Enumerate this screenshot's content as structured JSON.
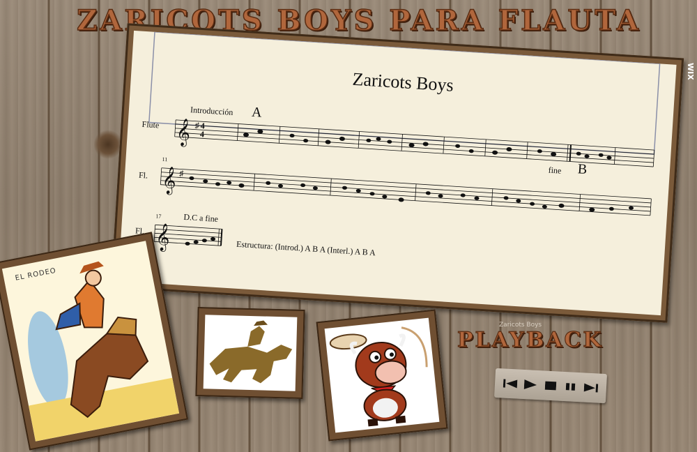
{
  "site": {
    "title": "ZARICOTS BOYS PARA FLAUTA",
    "wix_badge": "WIX"
  },
  "score": {
    "title": "Zaricots Boys",
    "instrument_first": "Flute",
    "instrument_short": "Fl.",
    "intro_label": "Introducción",
    "section_a": "A",
    "section_b": "B",
    "fine_label": "fine",
    "measure_11": "11",
    "measure_17": "17",
    "dc_label": "D.C a fine",
    "structure": "Estructura: (Introd.) A B A  (Interl.) A B A"
  },
  "pictures": {
    "rodeo_label": "EL RODEO"
  },
  "playback": {
    "title": "PLAYBACK",
    "track": "Zaricots Boys",
    "buttons": [
      "skip-back-icon",
      "play-icon",
      "stop-icon",
      "pause-icon",
      "skip-forward-icon"
    ]
  },
  "colors": {
    "title_fill": "#b0663c",
    "frame_wood": "#7a5a3a",
    "paper": "#f5efdc"
  }
}
